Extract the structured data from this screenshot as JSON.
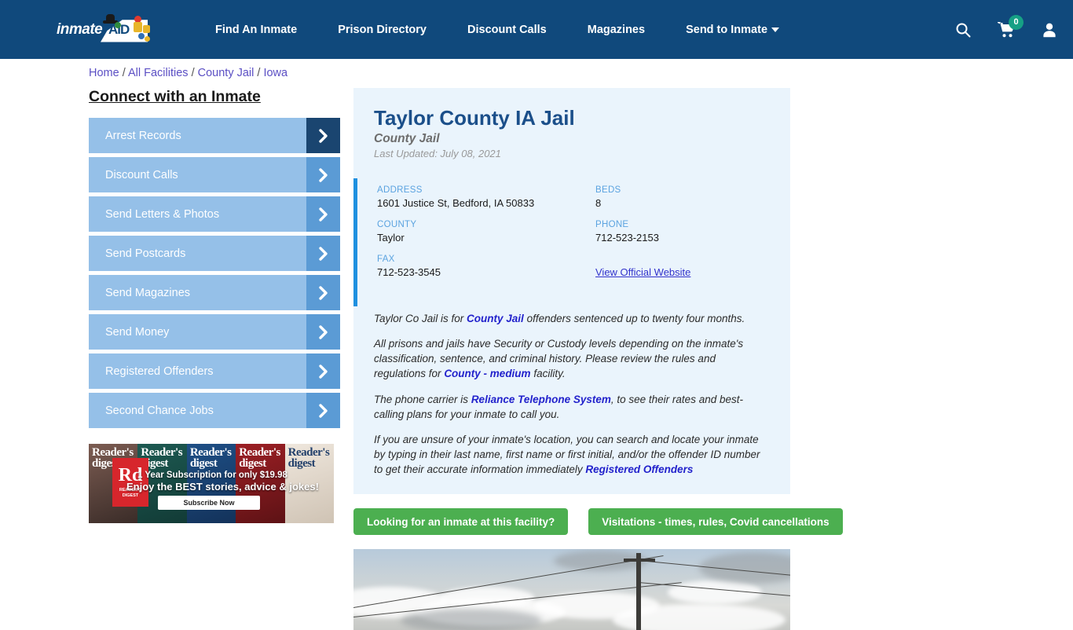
{
  "header": {
    "logo_text": "inmate",
    "logo_badge": "AID",
    "nav": [
      {
        "label": "Find An Inmate",
        "name": "nav-find-an-inmate"
      },
      {
        "label": "Prison Directory",
        "name": "nav-prison-directory"
      },
      {
        "label": "Discount Calls",
        "name": "nav-discount-calls"
      },
      {
        "label": "Magazines",
        "name": "nav-magazines"
      },
      {
        "label": "Send to Inmate",
        "name": "nav-send-to-inmate",
        "has_caret": true
      }
    ],
    "icons": {
      "search": "search-icon",
      "cart": "cart-icon",
      "cart_count": "0",
      "account": "user-account-icon"
    },
    "background_color": "#10497c",
    "cart_badge_color": "#16a085"
  },
  "breadcrumb": {
    "items": [
      "Home",
      "All Facilities",
      "County Jail",
      "Iowa"
    ],
    "separator": "/"
  },
  "sidebar": {
    "heading": "Connect with an Inmate",
    "items": [
      {
        "label": "Arrest Records"
      },
      {
        "label": "Discount Calls"
      },
      {
        "label": "Send Letters & Photos"
      },
      {
        "label": "Send Postcards"
      },
      {
        "label": "Send Magazines"
      },
      {
        "label": "Send Money"
      },
      {
        "label": "Registered Offenders"
      },
      {
        "label": "Second Chance Jobs"
      }
    ],
    "button_color": "#95c0e8",
    "arrow_color": "#5b9bd5",
    "arrow_active_color": "#1a4570"
  },
  "ad": {
    "brand": "Rd",
    "brand_sub": "READER'S DIGEST",
    "line1": "1 Year Subscription for only $19.98",
    "line2": "Enjoy the BEST stories, advice & jokes!",
    "cta": "Subscribe Now",
    "cover_titles": [
      "Reader's digest",
      "Reader's digest",
      "Reader's digest",
      "Reader's digest",
      "Reader's digest"
    ]
  },
  "facility": {
    "title": "Taylor County IA Jail",
    "subtitle": "County Jail",
    "last_updated": "Last Updated: July 08, 2021",
    "accent_color": "#1e90e0",
    "card_background": "#eaf4fc",
    "info": {
      "address_label": "ADDRESS",
      "address_value": "1601 Justice St, Bedford, IA 50833",
      "beds_label": "BEDS",
      "beds_value": "8",
      "county_label": "COUNTY",
      "county_value": "Taylor",
      "phone_label": "PHONE",
      "phone_value": "712-523-2153",
      "fax_label": "FAX",
      "fax_value": "712-523-3545",
      "website_link": "View Official Website"
    },
    "paragraphs": {
      "p1_a": "Taylor Co Jail is for ",
      "p1_link": "County Jail",
      "p1_b": " offenders sentenced up to twenty four months.",
      "p2_a": "All prisons and jails have Security or Custody levels depending on the inmate's classification, sentence, and criminal history. Please review the rules and regulations for ",
      "p2_link": "County - medium",
      "p2_b": " facility.",
      "p3_a": "The phone carrier is ",
      "p3_link": "Reliance Telephone System",
      "p3_b": ", to see their rates and best-calling plans for your inmate to call you.",
      "p4_a": "If you are unsure of your inmate's location, you can search and locate your inmate by typing in their last name, first name or first initial, and/or the offender ID number to get their accurate information immediately ",
      "p4_link": "Registered Offenders"
    },
    "cta_buttons": [
      {
        "label": "Looking for an inmate at this facility?"
      },
      {
        "label": "Visitations - times, rules, Covid cancellations"
      }
    ],
    "cta_color": "#4caf50",
    "photo_alt": "Taylor County IA Jail exterior sky with utility pole"
  }
}
